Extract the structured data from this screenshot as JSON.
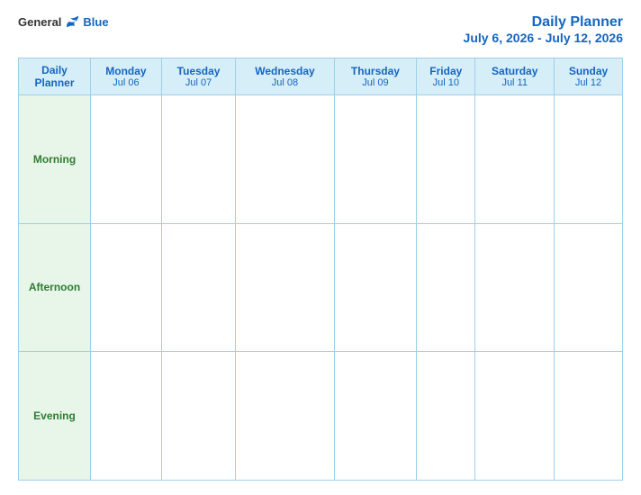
{
  "logo": {
    "general": "General",
    "blue": "Blue"
  },
  "header": {
    "title": "Daily Planner",
    "date_range": "July 6, 2026 - July 12, 2026"
  },
  "table": {
    "first_col": {
      "header_line1": "Daily",
      "header_line2": "Planner"
    },
    "columns": [
      {
        "day": "Monday",
        "date": "Jul 06"
      },
      {
        "day": "Tuesday",
        "date": "Jul 07"
      },
      {
        "day": "Wednesday",
        "date": "Jul 08"
      },
      {
        "day": "Thursday",
        "date": "Jul 09"
      },
      {
        "day": "Friday",
        "date": "Jul 10"
      },
      {
        "day": "Saturday",
        "date": "Jul 11"
      },
      {
        "day": "Sunday",
        "date": "Jul 12"
      }
    ],
    "rows": [
      {
        "label": "Morning"
      },
      {
        "label": "Afternoon"
      },
      {
        "label": "Evening"
      }
    ]
  }
}
